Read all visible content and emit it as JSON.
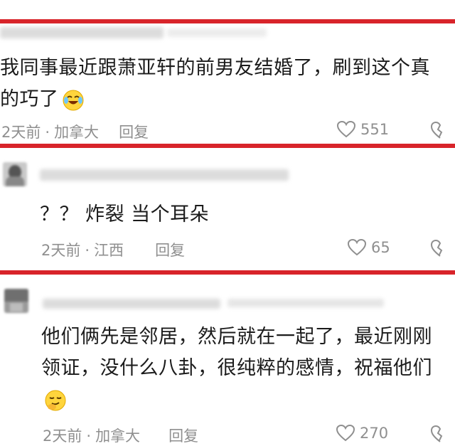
{
  "comments": [
    {
      "text": "我同事最近跟萧亚轩的前男友结婚了，刷到这个真的巧了",
      "emoji": "laughing-tears-emoji",
      "time": "2天前",
      "separator": "·",
      "location": "加拿大",
      "reply_label": "回复",
      "likes": "551"
    },
    {
      "text": "？？ 炸裂 当个耳朵",
      "time": "2天前",
      "separator": "·",
      "location": "江西",
      "reply_label": "回复",
      "likes": "65"
    },
    {
      "text": "他们俩先是邻居，然后就在一起了，最近刚刚领证，没什么八卦，很纯粹的感情，祝福他们",
      "emoji": "smirk-hand-emoji",
      "time": "2天前",
      "separator": "·",
      "location": "加拿大",
      "reply_label": "回复",
      "likes": "270"
    }
  ],
  "colors": {
    "divider": "#d8242a",
    "meta": "#8f8f8f",
    "text": "#1b1b1b"
  },
  "icons": {
    "like": "heart-outline-icon",
    "dislike": "broken-heart-icon"
  }
}
